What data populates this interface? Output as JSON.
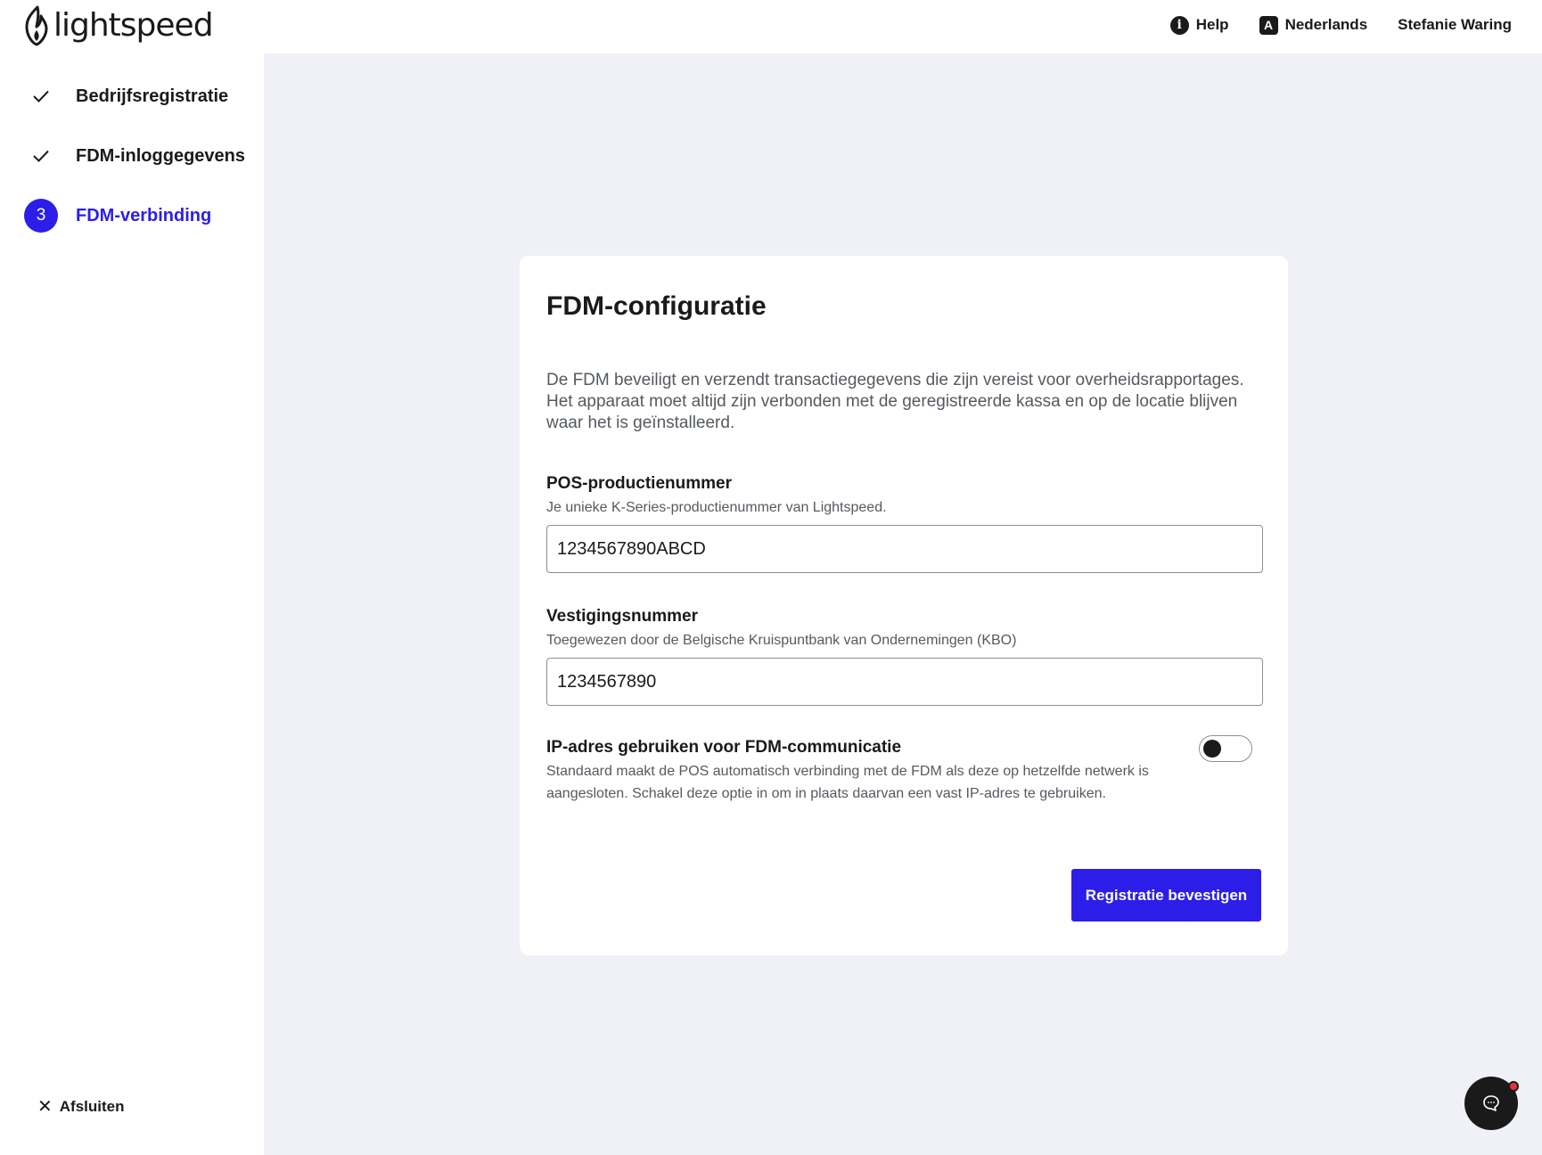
{
  "header": {
    "logo_text": "lightspeed",
    "help_label": "Help",
    "help_icon": "info-icon",
    "language_label": "Nederlands",
    "language_icon": "translate-icon",
    "user_name": "Stefanie Waring"
  },
  "sidebar": {
    "steps": [
      {
        "label": "Bedrijfsregistratie",
        "status": "completed",
        "icon": "check-icon"
      },
      {
        "label": "FDM-inloggegevens",
        "status": "completed",
        "icon": "check-icon"
      },
      {
        "label": "FDM-verbinding",
        "status": "active",
        "number": "3"
      }
    ],
    "close_label": "Afsluiten",
    "close_icon": "close-icon"
  },
  "card": {
    "title": "FDM-configuratie",
    "description": "De FDM beveiligt en verzendt transactiegegevens die zijn vereist voor overheidsrapportages. Het apparaat moet altijd zijn verbonden met de geregistreerde kassa en op de locatie blijven waar het is geïnstalleerd.",
    "pos_field": {
      "label": "POS-productienummer",
      "help": "Je unieke K-Series-productienummer van Lightspeed.",
      "value": "1234567890ABCD"
    },
    "branch_field": {
      "label": "Vestigingsnummer",
      "help": "Toegewezen door de Belgische Kruispuntbank van Ondernemingen (KBO)",
      "value": "1234567890"
    },
    "ip_toggle": {
      "label": "IP-adres gebruiken voor FDM-communicatie",
      "help": "Standaard maakt de POS automatisch verbinding met de FDM als deze op hetzelfde netwerk is aangesloten. Schakel deze optie in om in plaats daarvan een vast IP-adres te gebruiken.",
      "enabled": false
    },
    "confirm_label": "Registratie bevestigen"
  },
  "chat": {
    "icon": "chat-icon",
    "has_notification": true
  },
  "colors": {
    "accent": "#2c1ee8",
    "background": "#f0f1f6",
    "text": "#1a1a1a",
    "muted_text": "#555a60",
    "notification": "#e8323c"
  }
}
